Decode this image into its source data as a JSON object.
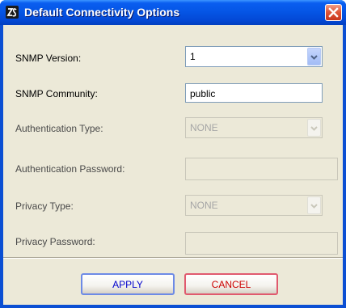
{
  "window": {
    "title": "Default Connectivity Options"
  },
  "form": {
    "snmp_version": {
      "label": "SNMP Version:",
      "value": "1"
    },
    "snmp_community": {
      "label": "SNMP Community:",
      "value": "public"
    },
    "auth_type": {
      "label": "Authentication Type:",
      "value": "NONE"
    },
    "auth_password": {
      "label": "Authentication Password:",
      "value": ""
    },
    "privacy_type": {
      "label": "Privacy Type:",
      "value": "NONE"
    },
    "privacy_password": {
      "label": "Privacy Password:",
      "value": ""
    }
  },
  "buttons": {
    "apply": "APPLY",
    "cancel": "CANCEL"
  },
  "colors": {
    "titlebar": "#0556e6",
    "dialog_bg": "#ece9d8",
    "close_button": "#e0573a"
  }
}
